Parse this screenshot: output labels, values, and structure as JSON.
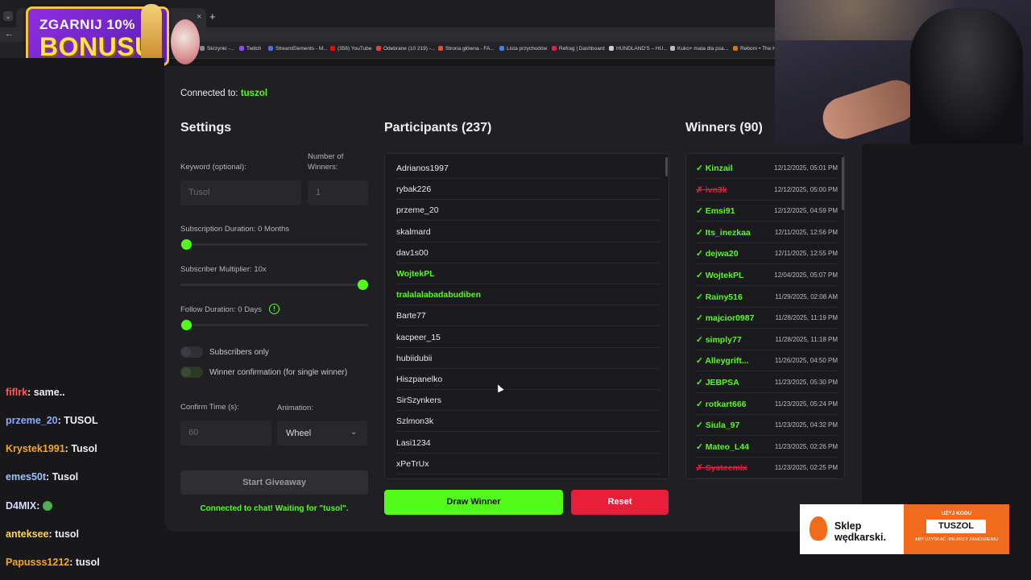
{
  "browser": {
    "tab_close": "×",
    "tab_new": "+",
    "bookmarks": [
      "Skrzynki -...",
      "Twitch",
      "StreamElements - M...",
      "(356) YouTube",
      "Odebrane (10 219) -...",
      "Strona główna - FA...",
      "Lista przychodów",
      "Refrag | Dashboard",
      "HUNDLAND'S – HU...",
      "Kuko+ mata dla psa...",
      "Reborn • The Ho"
    ]
  },
  "bonus": {
    "line1": "ZGARNIJ 10%",
    "line2": "BONUSU"
  },
  "chat": [
    {
      "user": "fiflrk",
      "sep": ": ",
      "msg": "same..",
      "color": "#ff5a5a"
    },
    {
      "user": "przeme_20",
      "sep": ": ",
      "msg": "TUSOL",
      "color": "#8aa9ff"
    },
    {
      "user": "Krystek1991",
      "sep": ": ",
      "msg": "Tusol",
      "color": "#f5a623"
    },
    {
      "user": "emes50t",
      "sep": ": ",
      "msg": "Tusol",
      "color": "#9ec2ff"
    },
    {
      "user": "D4MIX",
      "sep": ": ",
      "msg": "",
      "color": "#d9d9ff"
    },
    {
      "user": "anteksee",
      "sep": ": ",
      "msg": "tusol",
      "color": "#ffd54a"
    },
    {
      "user": "Papusss1212",
      "sep": ": ",
      "msg": "tusol",
      "color": "#f5a623"
    }
  ],
  "app": {
    "connected_prefix": "Connected to: ",
    "connected_user": "tuszol",
    "settings": {
      "title": "Settings",
      "keyword_label": "Keyword (optional):",
      "keyword_placeholder": "Tusol",
      "winners_label_1": "Number of",
      "winners_label_2": "Winners:",
      "winners_value": "1",
      "sub_duration_label": "Subscription Duration: 0 Months",
      "sub_multiplier_label": "Subscriber Multiplier: 10x",
      "follow_duration_label": "Follow Duration: 0 Days",
      "info_glyph": "!",
      "subscribers_only": "Subscribers only",
      "winner_confirmation": "Winner confirmation (for single winner)",
      "confirm_time_label": "Confirm Time (s):",
      "confirm_time_value": "60",
      "animation_label": "Animation:",
      "animation_value": "Wheel",
      "chevron_glyph": "⌄",
      "start_button": "Start Giveaway",
      "status": "Connected to chat! Waiting for \"tusol\"."
    },
    "participants": {
      "title": "Participants (237)",
      "items": [
        {
          "name": "Adrianos1997",
          "highlight": false
        },
        {
          "name": "rybak226",
          "highlight": false
        },
        {
          "name": "przeme_20",
          "highlight": false
        },
        {
          "name": "skalmard",
          "highlight": false
        },
        {
          "name": "dav1s00",
          "highlight": false
        },
        {
          "name": "WojtekPL",
          "highlight": true
        },
        {
          "name": "tralalalabadabudiben",
          "highlight": true
        },
        {
          "name": "Barte77",
          "highlight": false
        },
        {
          "name": "kacpeer_15",
          "highlight": false
        },
        {
          "name": "hubiidubii",
          "highlight": false
        },
        {
          "name": "Hiszpanelko",
          "highlight": false
        },
        {
          "name": "SirSzynkers",
          "highlight": false
        },
        {
          "name": "Szlmon3k",
          "highlight": false
        },
        {
          "name": "Lasi1234",
          "highlight": false
        },
        {
          "name": "xPeTrUx",
          "highlight": false
        }
      ],
      "draw_button": "Draw Winner",
      "reset_button": "Reset"
    },
    "winners": {
      "title": "Winners (90)",
      "items": [
        {
          "name": "✓ Kinzail",
          "date": "12/12/2025, 05:01 PM",
          "rejected": false
        },
        {
          "name": "✗ ivn3k",
          "date": "12/12/2025, 05:00 PM",
          "rejected": true
        },
        {
          "name": "✓ Emsi91",
          "date": "12/12/2025, 04:59 PM",
          "rejected": false
        },
        {
          "name": "✓ Its_inezkaa",
          "date": "12/11/2025, 12:56 PM",
          "rejected": false
        },
        {
          "name": "✓ dejwa20",
          "date": "12/11/2025, 12:55 PM",
          "rejected": false
        },
        {
          "name": "✓ WojtekPL",
          "date": "12/04/2025, 05:07 PM",
          "rejected": false
        },
        {
          "name": "✓ Rainy516",
          "date": "11/29/2025, 02:08 AM",
          "rejected": false
        },
        {
          "name": "✓ majcior0987",
          "date": "11/28/2025, 11:19 PM",
          "rejected": false
        },
        {
          "name": "✓ simply77",
          "date": "11/28/2025, 11:18 PM",
          "rejected": false
        },
        {
          "name": "✓ Alleygrift...",
          "date": "11/26/2025, 04:50 PM",
          "rejected": false
        },
        {
          "name": "✓ JEBPSA",
          "date": "11/23/2025, 05:30 PM",
          "rejected": false
        },
        {
          "name": "✓ rotkart666",
          "date": "11/23/2025, 05:24 PM",
          "rejected": false
        },
        {
          "name": "✓ Siula_97",
          "date": "11/23/2025, 04:32 PM",
          "rejected": false
        },
        {
          "name": "✓ Mateo_L44",
          "date": "11/23/2025, 02:26 PM",
          "rejected": false
        },
        {
          "name": "✗ Systeemix",
          "date": "11/23/2025, 02:25 PM",
          "rejected": true
        }
      ]
    }
  },
  "sponsor": {
    "name_line1": "Sklep",
    "name_line2": "wędkarski.",
    "promo_line1": "UŻYJ KODU",
    "promo_code": "TUSZOL",
    "promo_line2": "ABY UZYSKAĆ -8% PRZY ZAMÓWIENIU"
  },
  "colors": {
    "accent": "#53fc18",
    "danger": "#e91e3a",
    "panel": "#202024"
  }
}
